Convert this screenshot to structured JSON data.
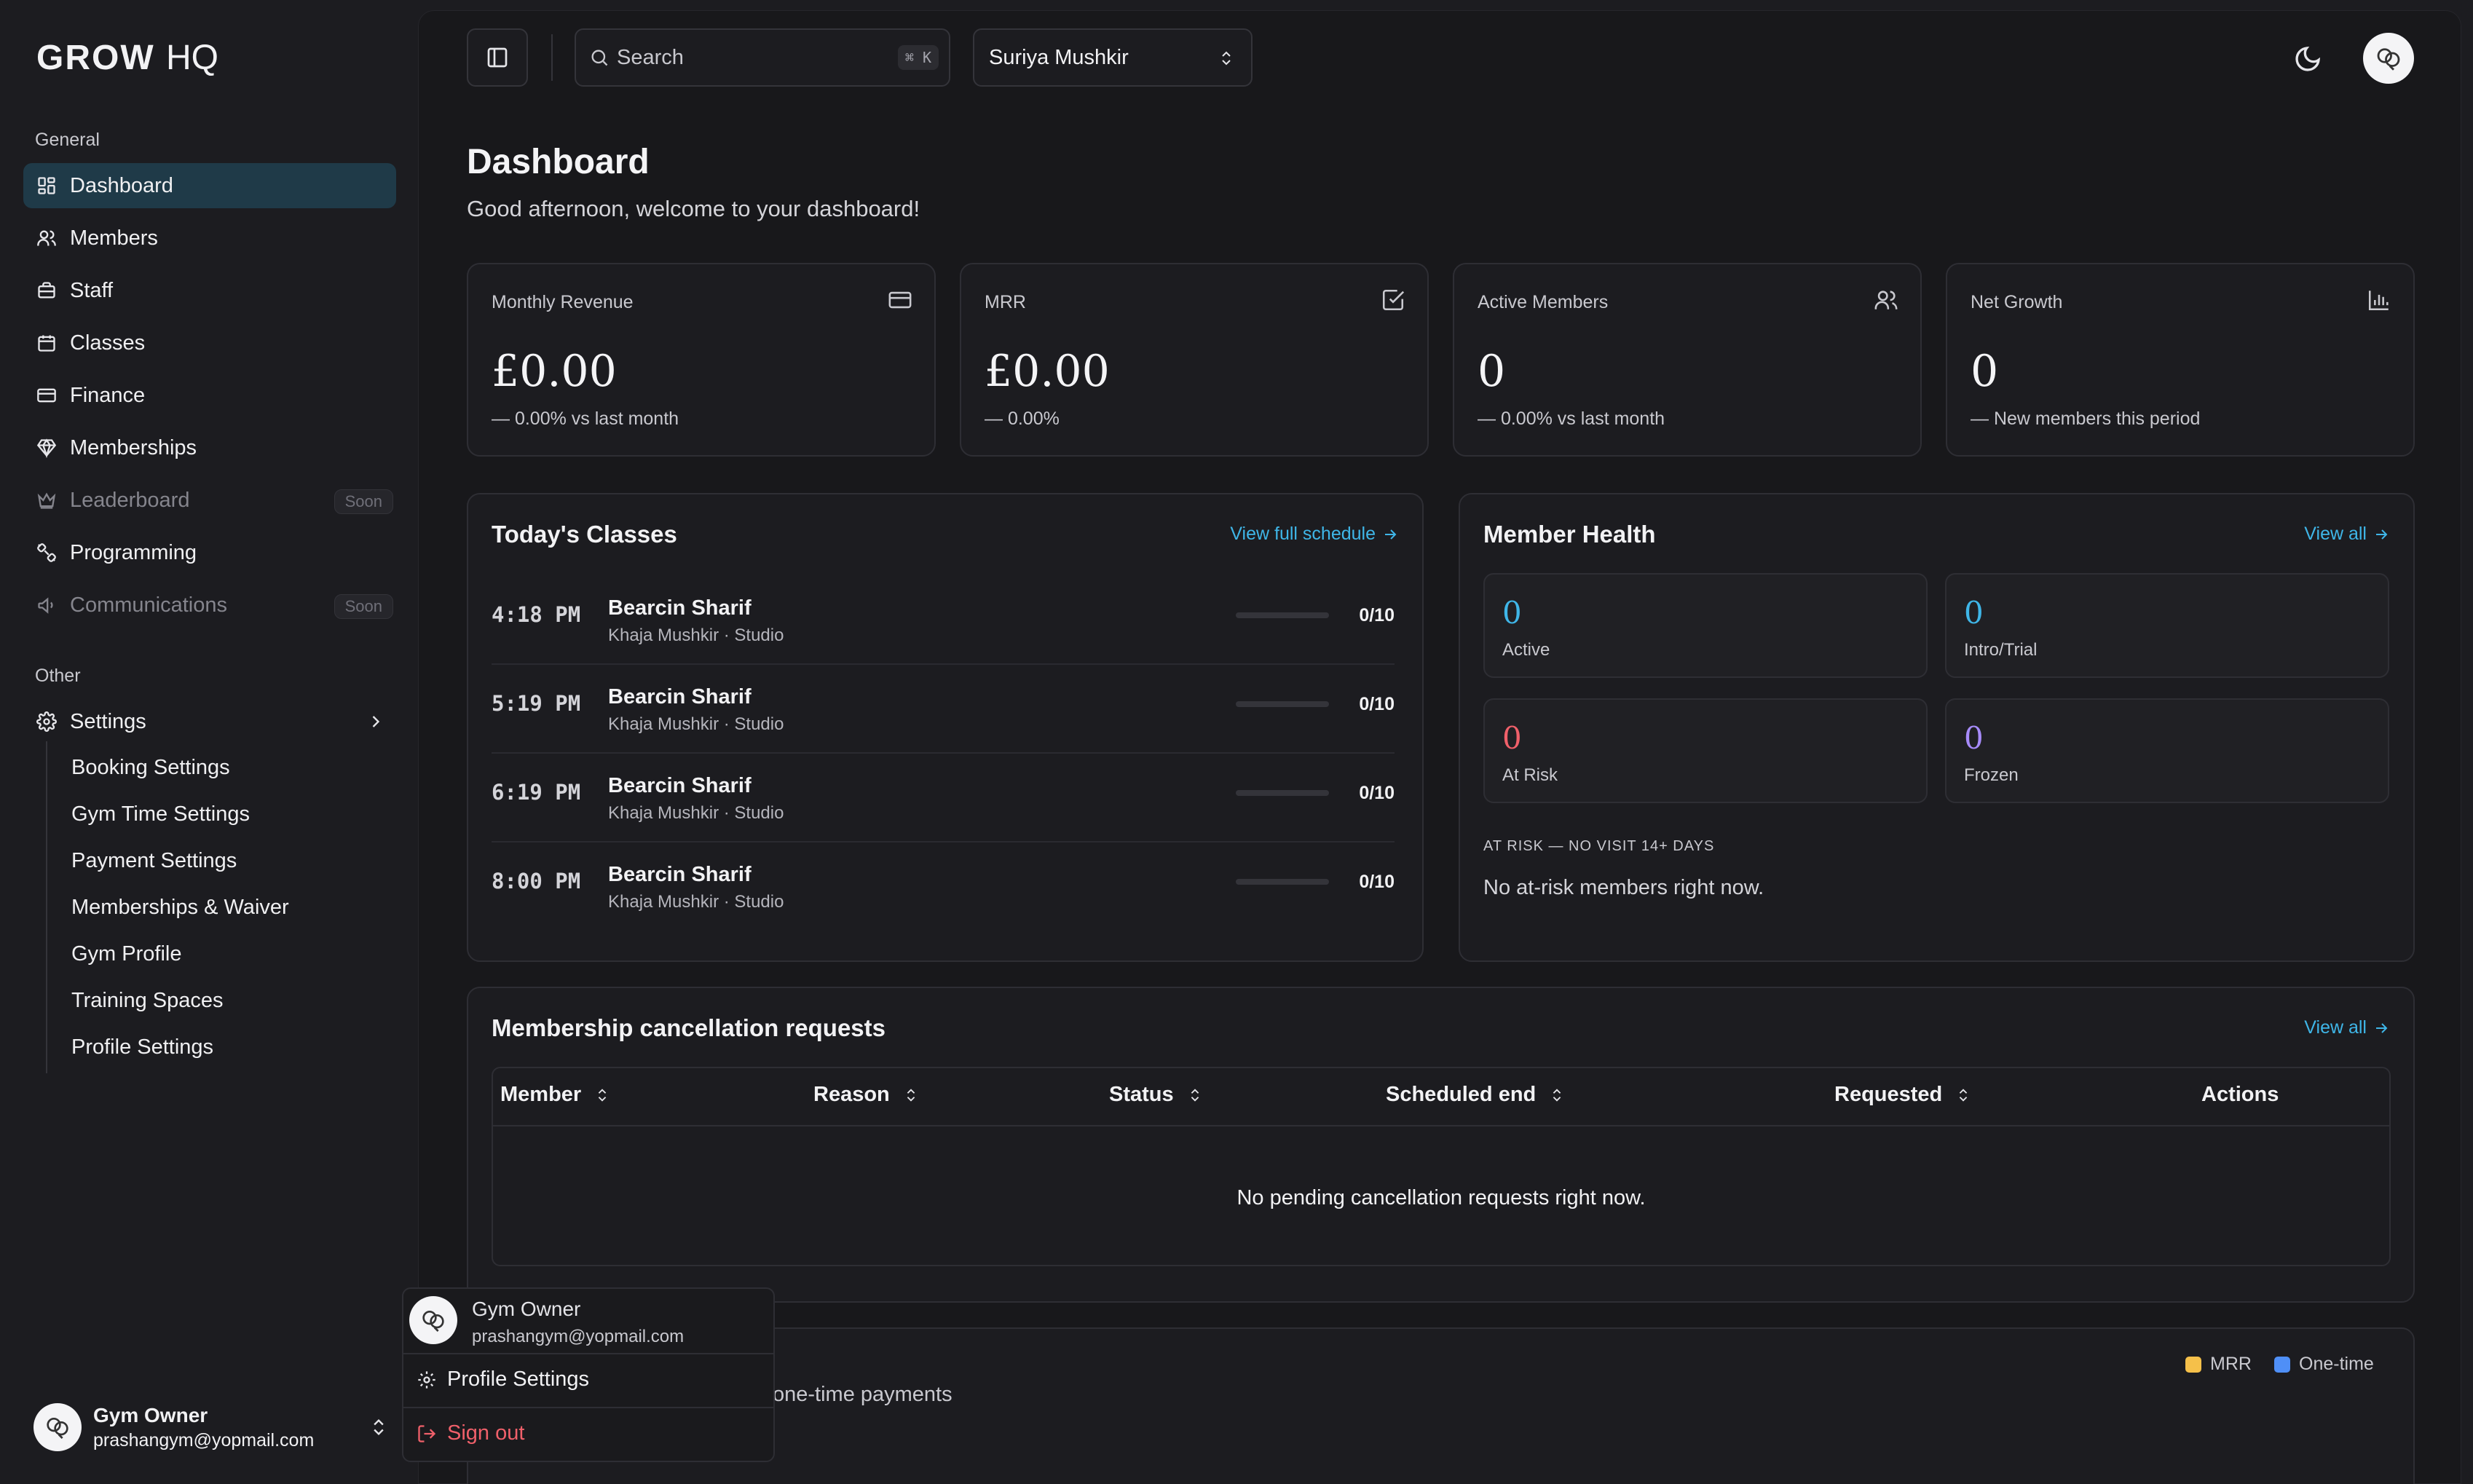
{
  "brand": {
    "logo_bold": "GROW",
    "logo_light": "HQ"
  },
  "sidebar": {
    "general_label": "General",
    "items": [
      {
        "label": "Dashboard",
        "icon": "dashboard-icon",
        "active": true
      },
      {
        "label": "Members",
        "icon": "users-icon"
      },
      {
        "label": "Staff",
        "icon": "briefcase-icon"
      },
      {
        "label": "Classes",
        "icon": "calendar-icon"
      },
      {
        "label": "Finance",
        "icon": "credit-card-icon"
      },
      {
        "label": "Memberships",
        "icon": "gem-icon"
      },
      {
        "label": "Leaderboard",
        "icon": "crown-icon",
        "badge": "Soon",
        "disabled": true
      },
      {
        "label": "Programming",
        "icon": "dumbbell-icon"
      },
      {
        "label": "Communications",
        "icon": "megaphone-icon",
        "badge": "Soon",
        "disabled": true
      }
    ],
    "other_label": "Other",
    "settings_label": "Settings",
    "settings_sub": [
      "Booking Settings",
      "Gym Time Settings",
      "Payment Settings",
      "Memberships & Waiver",
      "Gym Profile",
      "Training Spaces",
      "Profile Settings"
    ],
    "user": {
      "name": "Gym Owner",
      "email": "prashangym@yopmail.com"
    }
  },
  "topbar": {
    "search_placeholder": "Search",
    "search_shortcut": "⌘ K",
    "gym_selected": "Suriya Mushkir"
  },
  "header": {
    "title": "Dashboard",
    "subtitle": "Good afternoon, welcome to your dashboard!"
  },
  "stats": [
    {
      "label": "Monthly Revenue",
      "value": "£0.00",
      "delta": "0.00% vs last month",
      "icon": "credit-card-icon"
    },
    {
      "label": "MRR",
      "value": "£0.00",
      "delta": "0.00%",
      "icon": "check-square-icon"
    },
    {
      "label": "Active Members",
      "value": "0",
      "delta": "0.00% vs last month",
      "icon": "users-icon"
    },
    {
      "label": "Net Growth",
      "value": "0",
      "delta": "New members this period",
      "icon": "bar-chart-icon"
    }
  ],
  "classes": {
    "title": "Today's Classes",
    "link": "View full schedule",
    "rows": [
      {
        "time": "4:18 PM",
        "name": "Bearcin Sharif",
        "meta": "Khaja Mushkir · Studio",
        "count": "0/10",
        "fill": 0
      },
      {
        "time": "5:19 PM",
        "name": "Bearcin Sharif",
        "meta": "Khaja Mushkir · Studio",
        "count": "0/10",
        "fill": 0
      },
      {
        "time": "6:19 PM",
        "name": "Bearcin Sharif",
        "meta": "Khaja Mushkir · Studio",
        "count": "0/10",
        "fill": 0
      },
      {
        "time": "8:00 PM",
        "name": "Bearcin Sharif",
        "meta": "Khaja Mushkir · Studio",
        "count": "0/10",
        "fill": 0
      }
    ]
  },
  "health": {
    "title": "Member Health",
    "link": "View all",
    "boxes": [
      {
        "value": "0",
        "label": "Active",
        "color": "#3fb6e8"
      },
      {
        "value": "0",
        "label": "Intro/Trial",
        "color": "#3fb6e8"
      },
      {
        "value": "0",
        "label": "At Risk",
        "color": "#f0606a"
      },
      {
        "value": "0",
        "label": "Frozen",
        "color": "#a78bfa"
      }
    ],
    "risk_heading": "AT RISK — NO VISIT 14+ DAYS",
    "risk_empty": "No at-risk members right now."
  },
  "cancellations": {
    "title": "Membership cancellation requests",
    "link": "View all",
    "columns": [
      "Member",
      "Reason",
      "Status",
      "Scheduled end",
      "Requested",
      "Actions"
    ],
    "empty": "No pending cancellation requests right now."
  },
  "revenue": {
    "subtitle_fragment": "one-time payments",
    "legend": [
      {
        "label": "MRR",
        "color": "#f5c04a"
      },
      {
        "label": "One-time",
        "color": "#4f8ff7"
      }
    ]
  },
  "user_menu": {
    "name": "Gym Owner",
    "email": "prashangym@yopmail.com",
    "profile_settings": "Profile Settings",
    "sign_out": "Sign out",
    "sign_out_color": "#f0606a"
  },
  "colors": {
    "accent": "#3fb6e8",
    "active_nav": "#1f3a48"
  }
}
